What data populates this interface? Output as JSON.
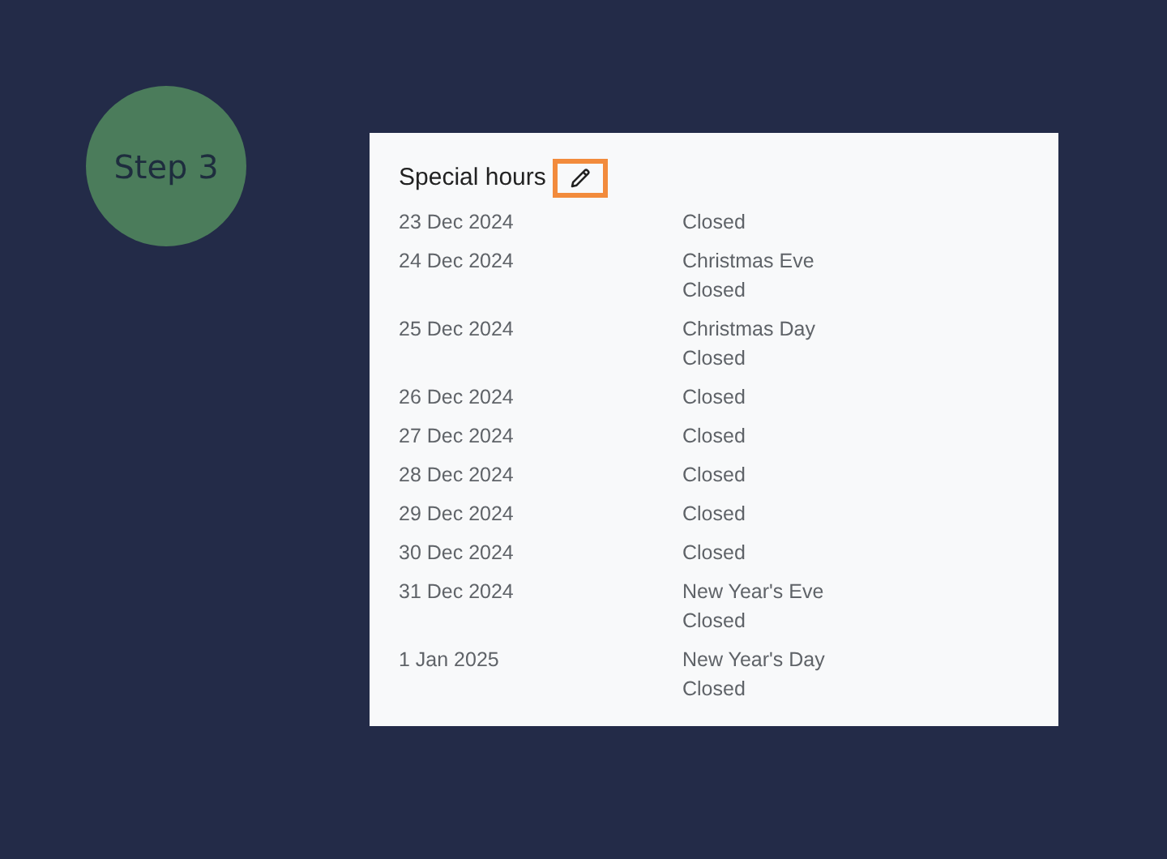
{
  "step_badge": "Step 3",
  "card": {
    "title": "Special hours",
    "rows": [
      {
        "date": "23 Dec 2024",
        "status": "Closed"
      },
      {
        "date": "24 Dec 2024",
        "holiday": "Christmas Eve",
        "status": "Closed"
      },
      {
        "date": "25 Dec 2024",
        "holiday": "Christmas Day",
        "status": "Closed"
      },
      {
        "date": "26 Dec 2024",
        "status": "Closed"
      },
      {
        "date": "27 Dec 2024",
        "status": "Closed"
      },
      {
        "date": "28 Dec 2024",
        "status": "Closed"
      },
      {
        "date": "29 Dec 2024",
        "status": "Closed"
      },
      {
        "date": "30 Dec 2024",
        "status": "Closed"
      },
      {
        "date": "31 Dec 2024",
        "holiday": "New Year's Eve",
        "status": "Closed"
      },
      {
        "date": "1 Jan 2025",
        "holiday": "New Year's Day",
        "status": "Closed"
      }
    ]
  }
}
